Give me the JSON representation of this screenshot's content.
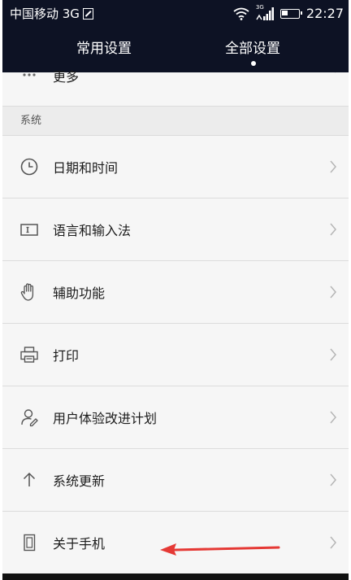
{
  "status_bar": {
    "carrier": "中国移动 3G",
    "network_label": "3G",
    "time": "22:27"
  },
  "tabs": [
    {
      "label": "常用设置",
      "active": false
    },
    {
      "label": "全部设置",
      "active": true
    }
  ],
  "list": {
    "partial_item": {
      "label": "更多",
      "icon": "more-dots-icon"
    },
    "section_title": "系统",
    "items": [
      {
        "label": "日期和时间",
        "icon": "clock-icon"
      },
      {
        "label": "语言和输入法",
        "icon": "keyboard-icon"
      },
      {
        "label": "辅助功能",
        "icon": "hand-icon"
      },
      {
        "label": "打印",
        "icon": "printer-icon"
      },
      {
        "label": "用户体验改进计划",
        "icon": "user-plan-icon"
      },
      {
        "label": "系统更新",
        "icon": "arrow-up-icon"
      },
      {
        "label": "关于手机",
        "icon": "phone-icon"
      }
    ]
  },
  "colors": {
    "header_bg": "#0d1224",
    "list_bg": "#f6f6f6",
    "arrow": "#e53935"
  }
}
